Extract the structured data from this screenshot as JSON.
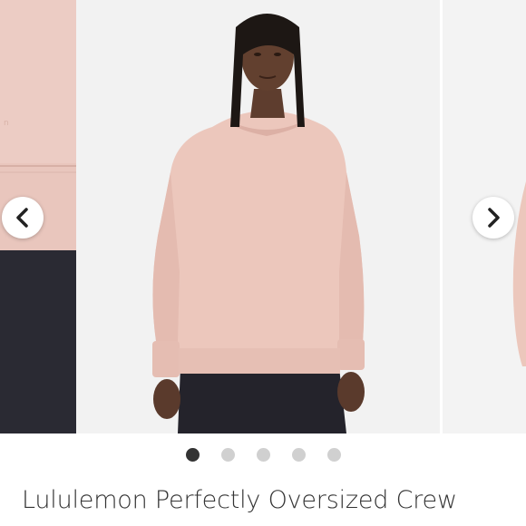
{
  "carousel": {
    "prev_button_icon": "chevron-left-icon",
    "next_button_icon": "chevron-right-icon",
    "dots": [
      {
        "active": true
      },
      {
        "active": false
      },
      {
        "active": false
      },
      {
        "active": false
      },
      {
        "active": false
      }
    ],
    "image_colors": {
      "sweatshirt": "#ecc7bc",
      "pants": "#23222a",
      "background": "#f2f2f2"
    }
  },
  "product": {
    "title": "Lululemon Perfectly Oversized Crew"
  }
}
